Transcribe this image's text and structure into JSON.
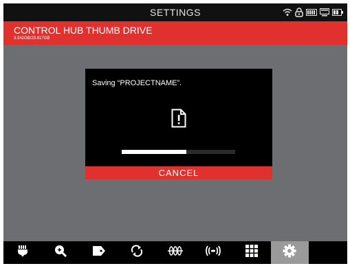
{
  "header": {
    "title": "SETTINGS"
  },
  "status_icons": [
    "wifi-icon",
    "lock-icon",
    "battery-icon",
    "display-icon",
    "device-battery-icon"
  ],
  "drive": {
    "name": "CONTROL HUB THUMB DRIVE",
    "capacity": "3.942GB/29.817GB"
  },
  "dialog": {
    "message": "Saving “PROJECTNAME”.",
    "icon": "file-warning-icon",
    "progress": 0.57,
    "cancel_label": "CANCEL"
  },
  "toolbar": {
    "active_index": 7,
    "items": [
      "brush-icon",
      "zoom-in-icon",
      "tag-icon",
      "rotate-icon",
      "grid-lines-icon",
      "broadcast-icon",
      "grid-icon",
      "gear-icon"
    ]
  },
  "colors": {
    "accent": "#e1312f",
    "background": "#6d6e71",
    "bars": "#111111"
  }
}
